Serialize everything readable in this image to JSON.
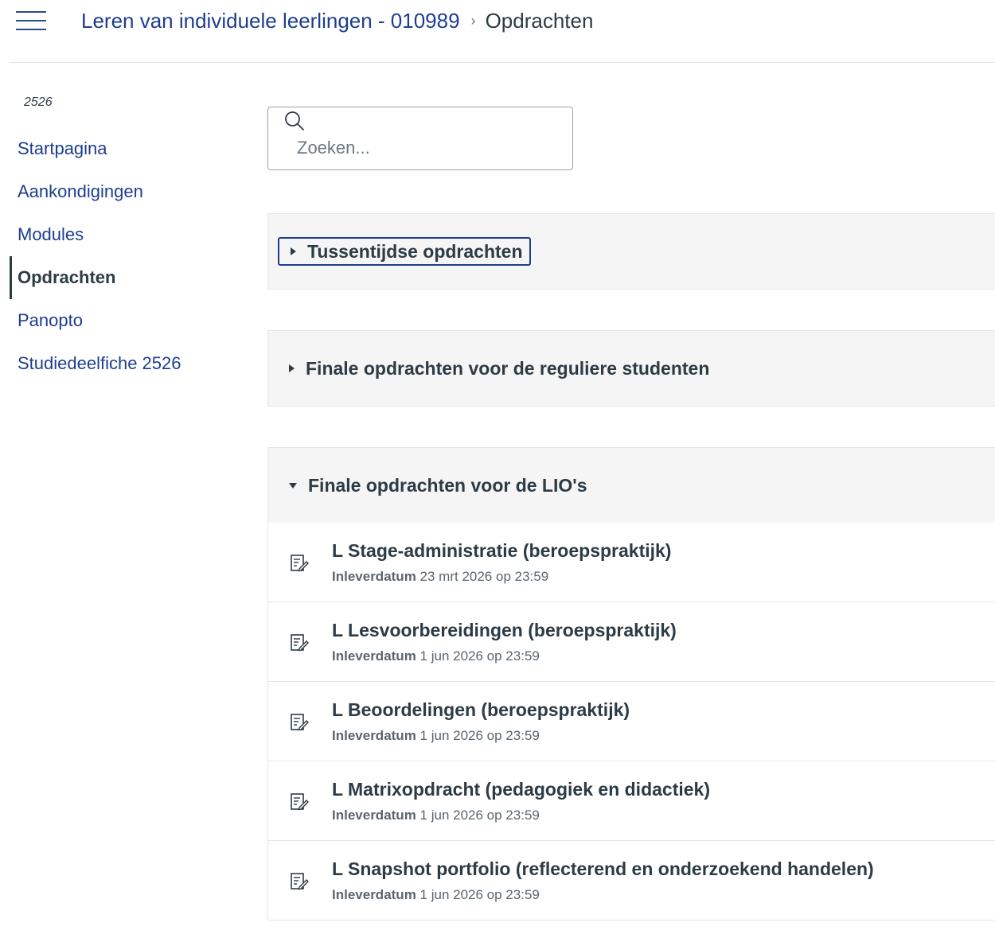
{
  "header": {
    "breadcrumb": [
      {
        "label": "Leren van individuele leerlingen - 010989"
      },
      {
        "label": "Opdrachten"
      }
    ],
    "separator": "›"
  },
  "sidebar": {
    "term": "2526",
    "items": [
      {
        "label": "Startpagina",
        "active": false
      },
      {
        "label": "Aankondigingen",
        "active": false
      },
      {
        "label": "Modules",
        "active": false
      },
      {
        "label": "Opdrachten",
        "active": true
      },
      {
        "label": "Panopto",
        "active": false
      },
      {
        "label": "Studiedeelfiche 2526",
        "active": false
      }
    ]
  },
  "search": {
    "placeholder": "Zoeken...",
    "value": ""
  },
  "groups": [
    {
      "title": "Tussentijdse opdrachten",
      "expanded": false,
      "focused": true
    },
    {
      "title": "Finale opdrachten voor de reguliere studenten",
      "expanded": false,
      "focused": false
    },
    {
      "title": "Finale opdrachten voor de LIO's",
      "expanded": true,
      "focused": false
    }
  ],
  "assignments": [
    {
      "title": "L Stage-administratie (beroepspraktijk)",
      "due_label": "Inleverdatum",
      "due": "23 mrt 2026 op 23:59"
    },
    {
      "title": "L Lesvoorbereidingen (beroepspraktijk)",
      "due_label": "Inleverdatum",
      "due": "1 jun 2026 op 23:59"
    },
    {
      "title": "L Beoordelingen (beroepspraktijk)",
      "due_label": "Inleverdatum",
      "due": "1 jun 2026 op 23:59"
    },
    {
      "title": "L Matrixopdracht (pedagogiek en didactiek)",
      "due_label": "Inleverdatum",
      "due": "1 jun 2026 op 23:59"
    },
    {
      "title": "L Snapshot portfolio (reflecterend en onderzoekend handelen)",
      "due_label": "Inleverdatum",
      "due": "1 jun 2026 op 23:59"
    }
  ],
  "icons": {
    "menu": "hamburger-menu-icon",
    "search": "search-icon",
    "assignment": "assignment-icon",
    "collapsed": "caret-right-icon",
    "expanded": "caret-down-icon"
  },
  "colors": {
    "link": "#1e3d8f",
    "text": "#2d3b45",
    "group_bg": "#f5f5f5",
    "border": "#e3e6e8"
  }
}
